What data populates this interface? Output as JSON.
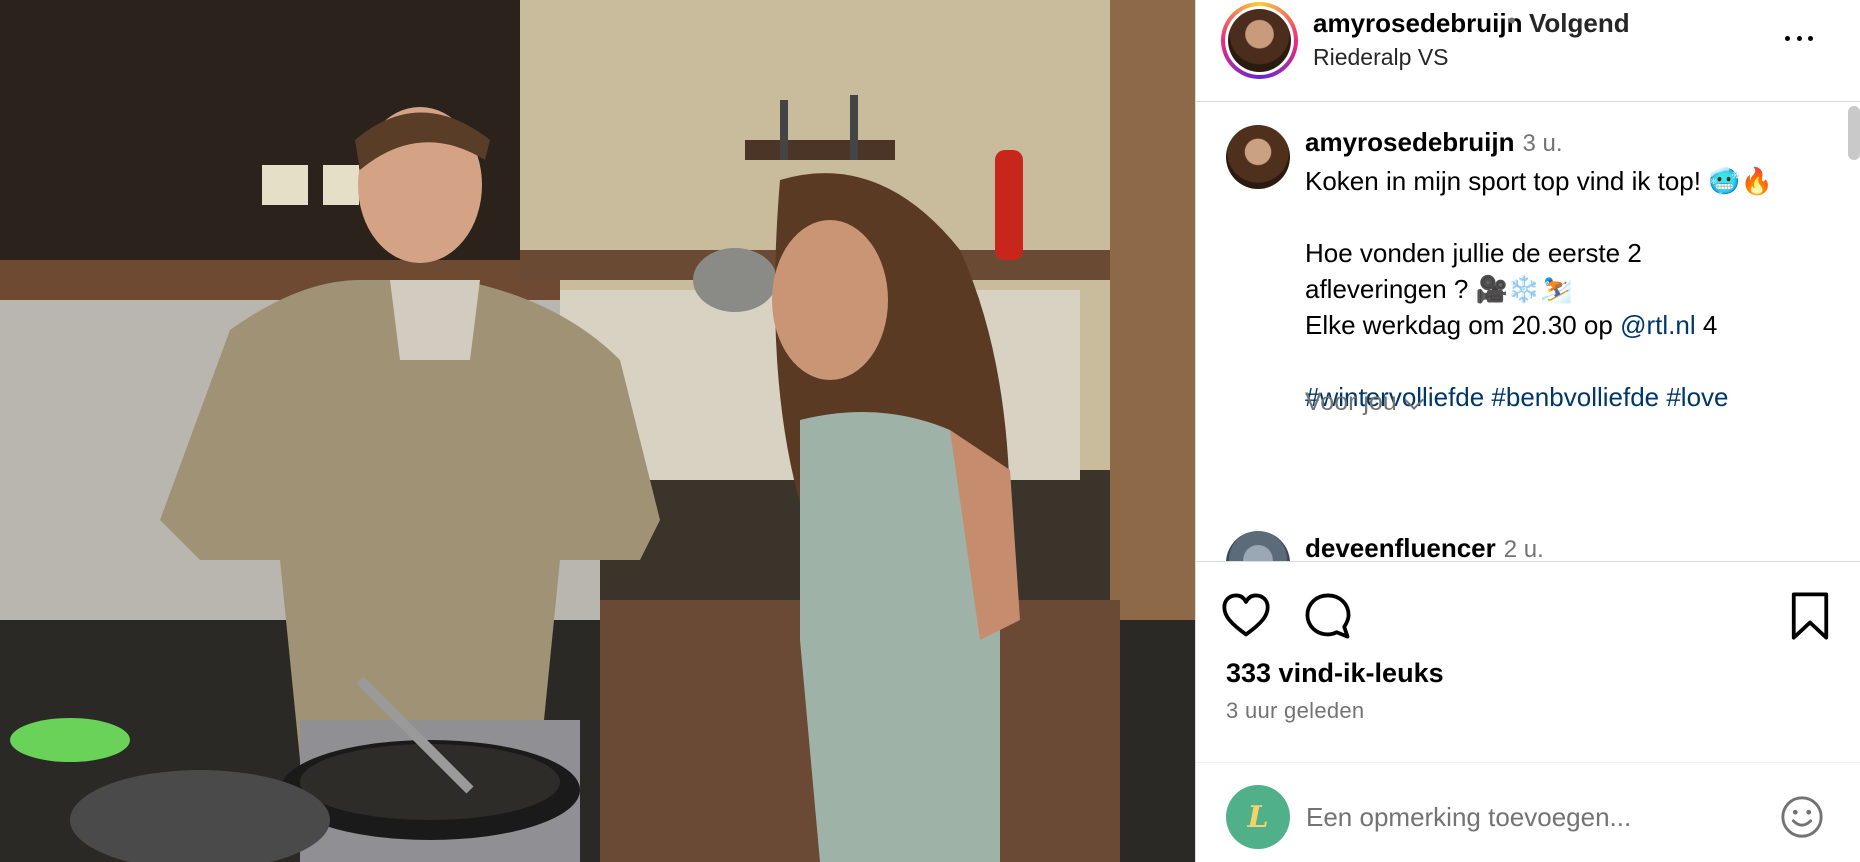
{
  "header": {
    "username": "amyrosedebruijn",
    "separator": "•",
    "follow_state": "Volgend",
    "location": "Riederalp VS"
  },
  "post": {
    "username": "amyrosedebruijn",
    "time": "3 u.",
    "caption_line1": "Koken in mijn sport top vind ik top! 🥶🔥",
    "caption_line2": "Hoe vonden jullie de eerste 2",
    "caption_line3": "afleveringen ? 🎥❄️⛷️",
    "caption_line4_pre": "Elke werkdag om 20.30 op ",
    "caption_mention": "@rtl.nl",
    "caption_line4_post": " 4",
    "hashtags": "#wintervolliefde #benbvolliefde #love",
    "translation_toggle": "Voor jou"
  },
  "comments": [
    {
      "username": "deveenfluencer",
      "time": "2 u."
    }
  ],
  "actions": {
    "likes": "333 vind-ik-leuks",
    "posted_ago": "3 uur geleden"
  },
  "composer": {
    "avatar_letter": "L",
    "placeholder": "Een opmerking toevoegen..."
  },
  "icons": {
    "more": "more-options-icon",
    "like": "heart-icon",
    "comment": "comment-bubble-icon",
    "save": "bookmark-icon",
    "emoji": "emoji-smiley-icon"
  },
  "colors": {
    "link": "#00376b",
    "muted": "#737373",
    "border": "#dbdbdb"
  }
}
